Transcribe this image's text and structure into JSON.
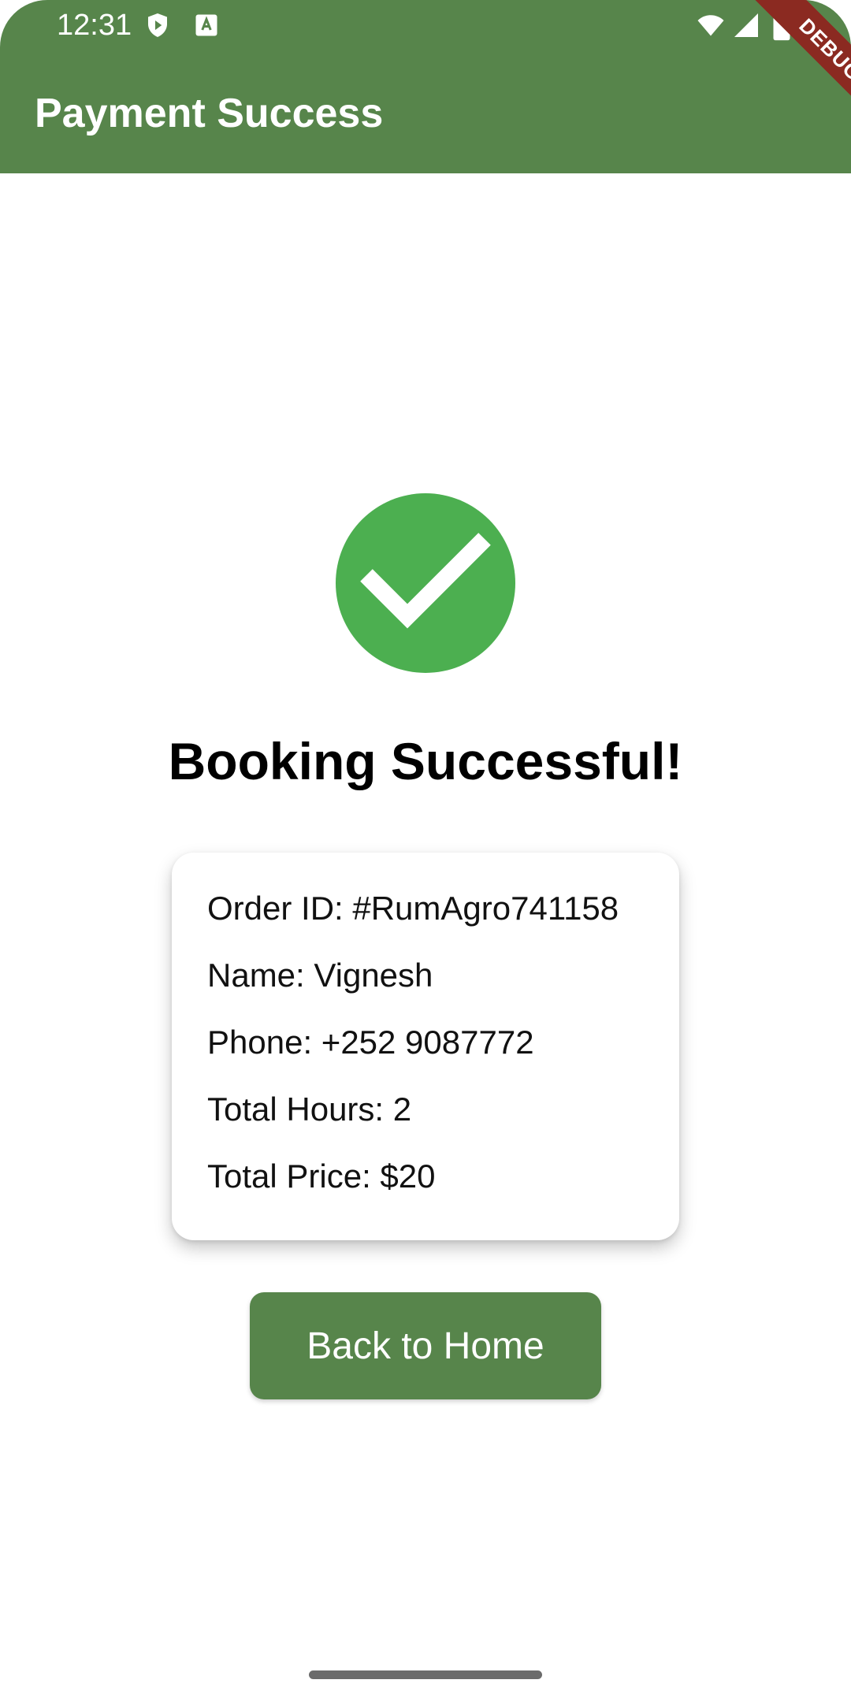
{
  "status_bar": {
    "time": "12:31",
    "icons": [
      "shield-play-icon",
      "font-a-icon",
      "wifi-icon",
      "cellular-signal-icon",
      "battery-icon"
    ]
  },
  "app_bar": {
    "title": "Payment Success",
    "debug_label": "DEBUG"
  },
  "main": {
    "success_icon": "check-circle-icon",
    "title": "Booking Successful!",
    "details": {
      "order_id": "Order ID: #RumAgro741158",
      "name": "Name: Vignesh",
      "phone": "Phone: +252 9087772",
      "total_hours": "Total Hours: 2",
      "total_price": "Total Price: $20"
    },
    "home_button_label": "Back to Home"
  },
  "colors": {
    "primary": "#57854b",
    "success": "#4caf50",
    "debug_banner": "#8b2a21"
  }
}
